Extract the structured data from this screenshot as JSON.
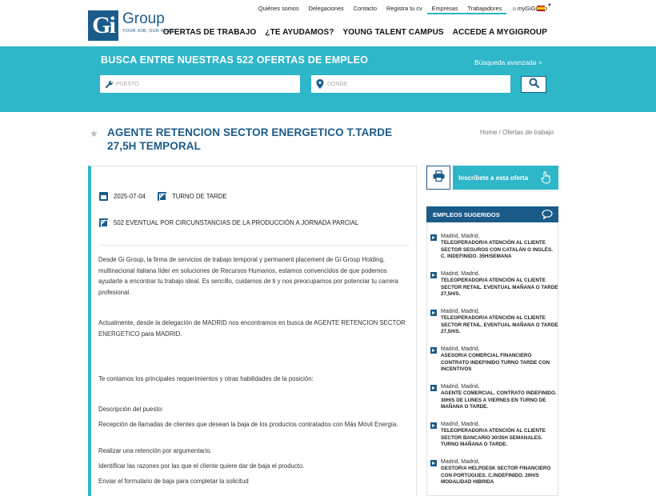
{
  "brand": {
    "logo_letter": "Gi",
    "name": "Group",
    "tagline": "YOUR JOB, OUR WORK"
  },
  "topnav": [
    {
      "label": "Quiénes somos",
      "active": false
    },
    {
      "label": "Delegaciones",
      "active": false
    },
    {
      "label": "Contacto",
      "active": false
    },
    {
      "label": "Registra tu cv",
      "active": false
    },
    {
      "label": "Empresas",
      "active": true
    },
    {
      "label": "Trabajadores",
      "active": true
    },
    {
      "label": "myGiGroup",
      "active": false
    }
  ],
  "mainnav": [
    "OFERTAS DE TRABAJO",
    "¿TE AYUDAMOS?",
    "YOUNG TALENT CAMPUS",
    "ACCEDE A MYGIGROUP"
  ],
  "search": {
    "title": "BUSCA ENTRE NUESTRAS  522 OFERTAS DE EMPLEO",
    "advanced": "Búsqueda avanzada >",
    "puesto_placeholder": "PUESTO",
    "donde_placeholder": "DÓNDE"
  },
  "job": {
    "title": "AGENTE RETENCION SECTOR ENERGETICO T.TARDE 27,5H TEMPORAL",
    "date": "2025-07-04",
    "shift": "TURNO DE TARDE",
    "contract": "502 EVENTUAL POR CIRCUNSTANCIAS DE LA PRODUCCIÓN A JORNADA PARCIAL",
    "paragraphs": [
      "Desde Gi Group, la firma de servicios de trabajo temporal y permanent placement de Gi Group Holding, multinacional italiana líder en soluciones de Recursos Humanos, estamos convencidos de que podemos ayudarte a encontrar tu trabajo ideal. Es sencillo, cuidamos de ti y nos preocupamos por potenciar tu carrera profesional.",
      "Actualmente, desde la delegación de MADRID nos encontramos en busca de AGENTE RETENCION SECTOR ENERGETICO para MADRID.",
      "Te contamos los principales requerimientos y otras habilidades de la posición:",
      "Descripción del puesto:",
      " Recepción de llamadas de clientes que desean la baja de los productos contratados con Más Móvil Energía.",
      " Realizar una retención por argumentario.",
      "Identificar las razones por las que el cliente quiere dar de baja el producto.",
      " Enviar el formulario de baja para completar la solicitud"
    ]
  },
  "breadcrumb": {
    "home": "Home",
    "sep": " / ",
    "current": "Ofertas de trabajo"
  },
  "sidebar": {
    "apply_label": "Inscríbete a esta oferta",
    "suggested_title": "EMPLEOS SUGERIDOS",
    "suggested": [
      {
        "location": "Madrid, Madrid,",
        "title": "TELEOPERADOR/A ATENCIÓN AL CLIENTE SECTOR SEGUROS CON CATALÁN O INGLÉS. C. INDEFINIDO. 35H/SEMANA"
      },
      {
        "location": "Madrid, Madrid,",
        "title": "TELEOPERADOR/A ATENCIÓN AL CLIENTE SECTOR RETAIL. EVENTUAL MAÑANA O TARDE 27,5H/S."
      },
      {
        "location": "Madrid, Madrid,",
        "title": "TELEOPERADOR/A ATENCIÓN AL CLIENTE SECTOR RETAIL. EVENTUAL MAÑANA O TARDE 27,5H/S."
      },
      {
        "location": "Madrid, Madrid,",
        "title": "ASESOR/A COMERCIAL FINANCIERO CONTRATO INDEFINIDO TURNO TARDE CON INCENTIVOS"
      },
      {
        "location": "Madrid, Madrid,",
        "title": "AGENTE COMERCIAL. CONTRATO INDEFINIDO. 30H/S DE LUNES A VIERNES EN TURNO DE MAÑANA O TARDE."
      },
      {
        "location": "Madrid, Madrid,",
        "title": "TELEOPERADOR/A ATENCIÓN AL CLIENTE SECTOR BANCARIO 30/35H SEMANALES. TURNO MAÑANA O TARDE."
      },
      {
        "location": "Madrid, Madrid,",
        "title": "GESTOR/A HELPDESK SECTOR FINANCIERO CON PORTUGUES. C.INDEFINIDO. 20H/S MODALIDAD HIBRIDA"
      }
    ]
  },
  "colors": {
    "brand_blue": "#1b5b8a",
    "accent_teal": "#2eb6c9"
  }
}
